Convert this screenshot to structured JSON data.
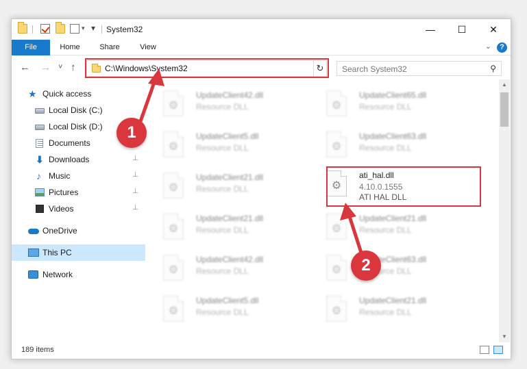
{
  "window": {
    "title": "System32",
    "minimize_glyph": "—",
    "maximize_glyph": "☐",
    "close_glyph": "✕"
  },
  "ribbon": {
    "tabs": [
      "File",
      "Home",
      "Share",
      "View"
    ],
    "help_glyph": "?",
    "collapse_glyph": "⌄"
  },
  "nav": {
    "address": "C:\\Windows\\System32",
    "search_placeholder": "Search System32",
    "back_glyph": "←",
    "forward_glyph": "→",
    "recent_glyph": "˅",
    "up_glyph": "↑",
    "dropdown_glyph": "⌄",
    "refresh_glyph": "↻",
    "search_glyph": "⚲"
  },
  "sidebar": {
    "items": [
      {
        "label": "Quick access",
        "icon": "star-icon"
      },
      {
        "label": "Local Disk (C:)",
        "icon": "disk-icon"
      },
      {
        "label": "Local Disk (D:)",
        "icon": "disk-icon"
      },
      {
        "label": "Documents",
        "icon": "document-icon"
      },
      {
        "label": "Downloads",
        "icon": "download-icon",
        "pinned": true
      },
      {
        "label": "Music",
        "icon": "music-icon",
        "pinned": true
      },
      {
        "label": "Pictures",
        "icon": "pictures-icon",
        "pinned": true
      },
      {
        "label": "Videos",
        "icon": "videos-icon",
        "pinned": true
      },
      {
        "label": "OneDrive",
        "icon": "cloud-icon"
      },
      {
        "label": "This PC",
        "icon": "computer-icon",
        "selected": true
      },
      {
        "label": "Network",
        "icon": "network-icon"
      }
    ],
    "pin_glyph": "📌"
  },
  "files": {
    "left": [
      {
        "name": "UpdateClient42.dll",
        "type": "Resource DLL"
      },
      {
        "name": "UpdateClient5.dll",
        "type": "Resource DLL"
      },
      {
        "name": "UpdateClient21.dll",
        "type": "Resource DLL"
      },
      {
        "name": "UpdateClient21.dll",
        "type": "Resource DLL"
      },
      {
        "name": "UpdateClient42.dll",
        "type": "Resource DLL"
      },
      {
        "name": "UpdateClient5.dll",
        "type": "Resource DLL"
      }
    ],
    "right": [
      {
        "name": "UpdateClient65.dll",
        "type": "Resource DLL"
      },
      {
        "name": "UpdateClient63.dll",
        "type": "Resource DLL"
      },
      {
        "name": "UpdateClient21.dll",
        "type": "Resource DLL"
      },
      {
        "name": "UpdateClient63.dll",
        "type": "Resource DLL"
      },
      {
        "name": "UpdateClient21.dll",
        "type": "Resource DLL"
      }
    ],
    "highlighted": {
      "name": "ati_hal.dll",
      "version": "4.10.0.1555",
      "description": "ATI HAL DLL"
    }
  },
  "status": {
    "item_count": "189 items"
  },
  "annotations": {
    "marker1": "1",
    "marker2": "2",
    "color": "#d9363e"
  },
  "colors": {
    "accent": "#1979ca",
    "selection": "#cce8ff"
  }
}
